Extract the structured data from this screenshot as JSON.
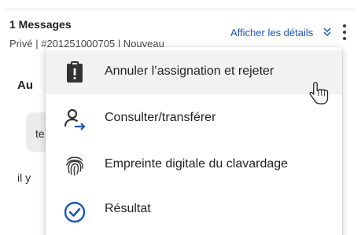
{
  "header": {
    "message_count": "1 Messages",
    "meta_text": "Privé  |  #201251000705  |  Nouveau",
    "details_link": "Afficher les détails",
    "details_chevron_icon": "double-chevron-down-icon",
    "more_menu_icon": "vertical-ellipsis-icon"
  },
  "background": {
    "title": "Au",
    "bubble_text": "te",
    "line_text": "il y"
  },
  "menu": {
    "items": [
      {
        "label": "Annuler l’assignation et rejeter",
        "icon": "clipboard-alert-icon"
      },
      {
        "label": "Consulter/transférer",
        "icon": "user-transfer-icon"
      },
      {
        "label": "Empreinte digitale du clavardage",
        "icon": "fingerprint-icon"
      },
      {
        "label": "Résultat",
        "icon": "check-circle-icon"
      }
    ]
  },
  "colors": {
    "link": "#1a56b8",
    "icon_dark": "#333333",
    "icon_blue": "#1a56b8",
    "hover_bg": "#f2f2f2"
  }
}
